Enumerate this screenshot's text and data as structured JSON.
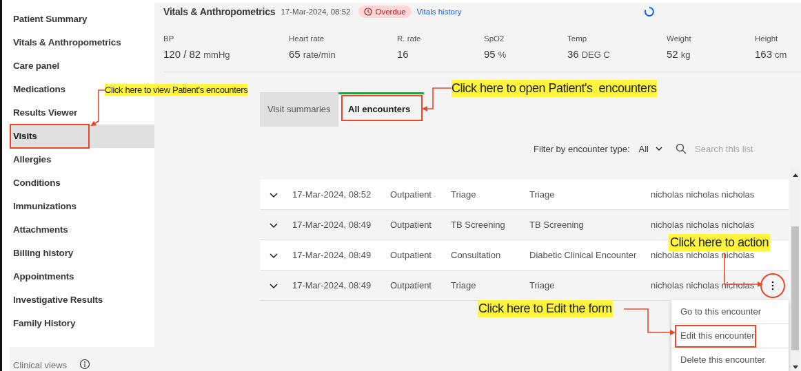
{
  "sidebar": {
    "items": [
      {
        "label": "Patient Summary",
        "selected": false,
        "highlighted": false
      },
      {
        "label": "Vitals & Anthropometrics",
        "selected": false,
        "highlighted": false
      },
      {
        "label": "Care panel",
        "selected": false,
        "highlighted": false
      },
      {
        "label": "Medications",
        "selected": false,
        "highlighted": false
      },
      {
        "label": "Results Viewer",
        "selected": false,
        "highlighted": false
      },
      {
        "label": "Visits",
        "selected": true,
        "highlighted": true
      },
      {
        "label": "Allergies",
        "selected": false,
        "highlighted": false
      },
      {
        "label": "Conditions",
        "selected": false,
        "highlighted": false
      },
      {
        "label": "Immunizations",
        "selected": false,
        "highlighted": false
      },
      {
        "label": "Attachments",
        "selected": false,
        "highlighted": false
      },
      {
        "label": "Billing history",
        "selected": false,
        "highlighted": false
      },
      {
        "label": "Appointments",
        "selected": false,
        "highlighted": false
      },
      {
        "label": "Investigative Results",
        "selected": false,
        "highlighted": false
      },
      {
        "label": "Family History",
        "selected": false,
        "highlighted": false
      }
    ],
    "footer": {
      "label": "Clinical views"
    }
  },
  "vitals": {
    "title": "Vitals & Anthropometrics",
    "date": "17-Mar-2024, 08:52",
    "status": "Overdue",
    "link": "Vitals history",
    "loading": true,
    "readings": [
      {
        "label": "BP",
        "value": "120 / 82",
        "unit": "mmHg"
      },
      {
        "label": "Heart rate",
        "value": "65",
        "unit": "rate/min"
      },
      {
        "label": "R. rate",
        "value": "16"
      },
      {
        "label": "SpO2",
        "value": "95",
        "unit": "%"
      },
      {
        "label": "Temp",
        "value": "36",
        "unit": "DEG C"
      },
      {
        "label": "Weight",
        "value": "52",
        "unit": "kg"
      },
      {
        "label": "Height",
        "value": "163",
        "unit": "cm"
      }
    ]
  },
  "tabs": [
    {
      "label": "Visit summaries",
      "selected": false,
      "highlighted": false
    },
    {
      "label": "All encounters",
      "selected": true,
      "highlighted": true
    }
  ],
  "filter": {
    "label": "Filter by encounter type:",
    "value": "All"
  },
  "search": {
    "placeholder": "Search this list"
  },
  "encounters": [
    {
      "date": "17-Mar-2024, 08:52",
      "type": "Outpatient",
      "encounter_type": "Triage",
      "form": "Triage",
      "provider": "nicholas nicholas nicholas",
      "circled": false,
      "menu_open": false
    },
    {
      "date": "17-Mar-2024, 08:49",
      "type": "Outpatient",
      "encounter_type": "TB Screening",
      "form": "TB Screening",
      "provider": "nicholas nicholas nicholas",
      "circled": false,
      "menu_open": false
    },
    {
      "date": "17-Mar-2024, 08:49",
      "type": "Outpatient",
      "encounter_type": "Consultation",
      "form": "Diabetic Clinical Encounter",
      "provider": "nicholas nicholas nicholas",
      "circled": false,
      "menu_open": false
    },
    {
      "date": "17-Mar-2024, 08:49",
      "type": "Outpatient",
      "encounter_type": "Triage",
      "form": "Triage",
      "provider": "nicholas nicholas nicholas",
      "circled": true,
      "menu_open": true
    }
  ],
  "action_menu": {
    "items": [
      {
        "label": "Go to this encounter",
        "highlighted": false
      },
      {
        "label": "Edit this encounter",
        "highlighted": true
      },
      {
        "label": "Delete this encounter",
        "highlighted": false
      }
    ]
  },
  "annotations": [
    {
      "text": "Click here to view Patient's encounters"
    },
    {
      "text": "Click here to open Patient's  encounters"
    },
    {
      "text": "Click here to action"
    },
    {
      "text": "Click here to Edit the form"
    }
  ]
}
